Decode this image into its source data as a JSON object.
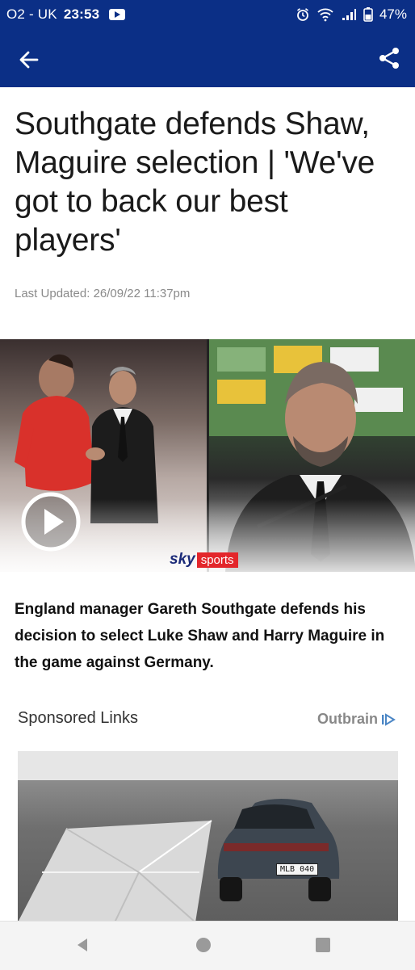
{
  "status_bar": {
    "carrier": "O2 - UK",
    "time": "23:53",
    "battery": "47%"
  },
  "app_bar": {
    "back_icon": "back-arrow-icon",
    "share_icon": "share-icon"
  },
  "article": {
    "headline": "Southgate defends Shaw, Maguire selection | 'We've got to back our best players'",
    "last_updated": "Last Updated: 26/09/22 11:37pm",
    "video": {
      "brand_sky": "sky",
      "brand_sports": "sports",
      "play_icon": "play-icon"
    },
    "summary": "England manager Gareth Southgate defends his decision to select Luke Shaw and Harry Maguire in the game against Germany."
  },
  "sponsored": {
    "title": "Sponsored Links",
    "provider": "Outbrain",
    "ad_plate": "MLB 040"
  },
  "nav": {
    "back_icon": "nav-back-icon",
    "home_icon": "nav-home-icon",
    "recents_icon": "nav-recents-icon"
  },
  "colors": {
    "header": "#0b2f86",
    "sky_red": "#e3262b"
  }
}
